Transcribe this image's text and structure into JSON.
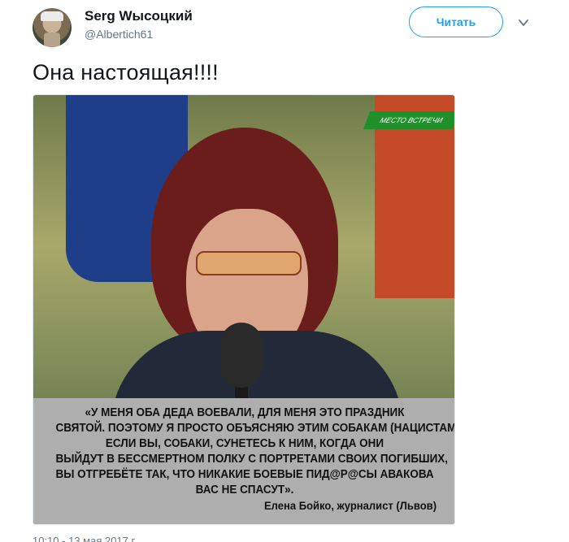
{
  "header": {
    "display_name": "Serg Wысоцкий",
    "handle": "@Albertich61",
    "follow_label": "Читать",
    "avatar_icon": "user-avatar",
    "menu_icon": "chevron-down-icon"
  },
  "tweet": {
    "text": "Она настоящая!!!!"
  },
  "media": {
    "banner_text": "МЕСТО ВСТРЕЧИ",
    "quote_lines": [
      "«У МЕНЯ ОБА ДЕДА ВОЕВАЛИ, ДЛЯ МЕНЯ ЭТО ПРАЗДНИК",
      "СВЯТОЙ. ПОЭТОМУ Я ПРОСТО  ОБЪЯСНЯЮ ЭТИМ СОБАКАМ (НАЦИСТАМ):",
      "ЕСЛИ ВЫ, СОБАКИ, СУНЕТЕСЬ К НИМ, КОГДА ОНИ",
      "ВЫЙДУТ В БЕССМЕРТНОМ ПОЛКУ С ПОРТРЕТАМИ СВОИХ ПОГИБШИХ,",
      "ВЫ ОТГРЕБЁТЕ ТАК, ЧТО НИКАКИЕ БОЕВЫЕ ПИД@Р@СЫ АВАКОВА",
      "ВАС НЕ СПАСУТ»."
    ],
    "attribution": "Елена Бойко, журналист (Львов)"
  },
  "footer": {
    "timestamp": "10:10 - 13 мая 2017 г."
  },
  "colors": {
    "accent": "#1da1f2",
    "secondary_text": "#657786",
    "primary_text": "#14171a"
  }
}
